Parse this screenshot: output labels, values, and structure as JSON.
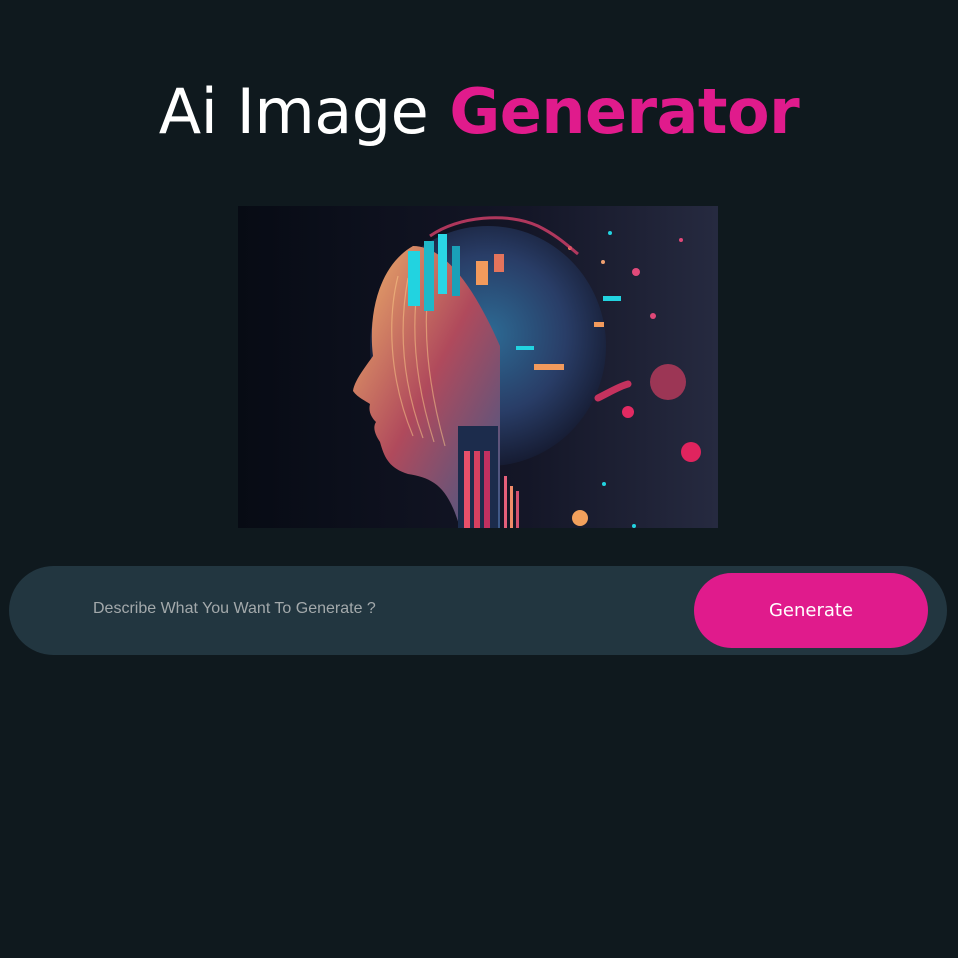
{
  "header": {
    "title_plain": "Ai Image",
    "title_accent": "Generator"
  },
  "hero_image": {
    "subject": "ai-circuit-head-illustration"
  },
  "prompt": {
    "placeholder": "Describe What You Want To Generate ?",
    "value": "",
    "button_label": "Generate"
  },
  "colors": {
    "background": "#0f191e",
    "accent": "#e01b8c",
    "bar": "#223640",
    "text": "#ffffff"
  }
}
